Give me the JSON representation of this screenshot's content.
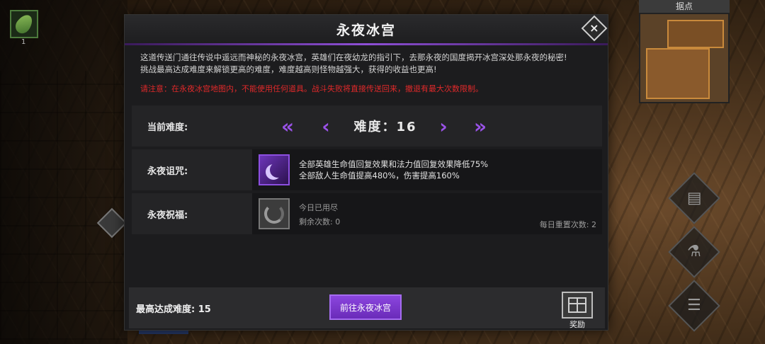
{
  "hud": {
    "item_count": "1",
    "minimap_title": "据点"
  },
  "dialog": {
    "title": "永夜冰宫",
    "close_label": "×",
    "description_line1": "这道传送门通往传说中遥远而神秘的永夜冰宫，英雄们在夜幼龙的指引下，去那永夜的国度揭开冰宫深处那永夜的秘密!",
    "description_line2": "挑战最高达成难度来解锁更高的难度，难度越高则怪物越强大，获得的收益也更高!",
    "warning": "请注意：在永夜冰宫地图内，不能使用任何道具。战斗失败将直接传送回来，撤退有最大次数限制。",
    "difficulty": {
      "label": "当前难度:",
      "value": "难度：16",
      "first_icon": "«",
      "prev_icon": "‹",
      "next_icon": "›",
      "last_icon": "»"
    },
    "curse": {
      "label": "永夜诅咒:",
      "effect1": "全部英雄生命值回复效果和法力值回复效果降低75%",
      "effect2": "全部敌人生命值提高480%，伤害提高160%"
    },
    "blessing": {
      "label": "永夜祝福:",
      "status": "今日已用尽",
      "remaining": "剩余次数: 0",
      "daily_reset": "每日重置次数: 2"
    },
    "footer": {
      "best_difficulty": "最高达成难度: 15",
      "go_button": "前往永夜冰宫",
      "reward_label": "奖励"
    }
  },
  "colors": {
    "accent_purple": "#8b45de",
    "warning_red": "#e0292a"
  }
}
